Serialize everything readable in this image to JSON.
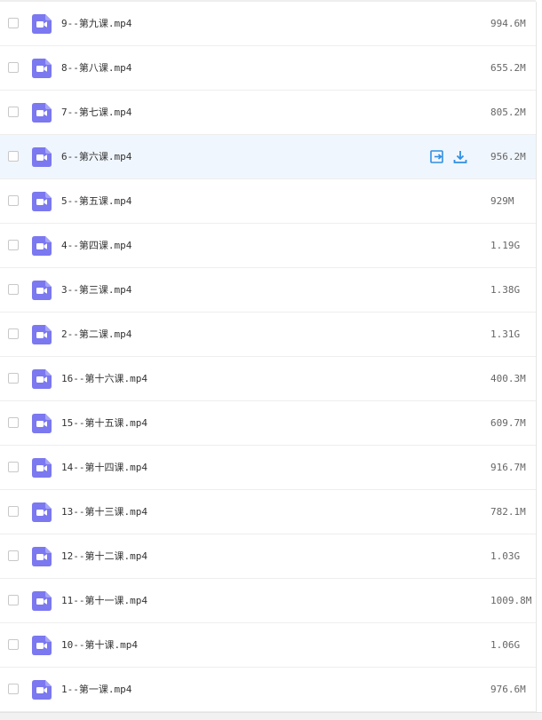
{
  "colors": {
    "icon_bg": "#7b78f0",
    "hover_bg": "#f0f6fd",
    "action_blue": "#2f8fe4",
    "divider": "#eeeeee"
  },
  "actions": {
    "share_icon": "share-icon",
    "download_icon": "download-icon"
  },
  "files": [
    {
      "name": "9--第九课.mp4",
      "size": "994.6M",
      "icon": "video-file-icon"
    },
    {
      "name": "8--第八课.mp4",
      "size": "655.2M",
      "icon": "video-file-icon"
    },
    {
      "name": "7--第七课.mp4",
      "size": "805.2M",
      "icon": "video-file-icon"
    },
    {
      "name": "6--第六课.mp4",
      "size": "956.2M",
      "icon": "video-file-icon",
      "hovered": true
    },
    {
      "name": "5--第五课.mp4",
      "size": "929M",
      "icon": "video-file-icon"
    },
    {
      "name": "4--第四课.mp4",
      "size": "1.19G",
      "icon": "video-file-icon"
    },
    {
      "name": "3--第三课.mp4",
      "size": "1.38G",
      "icon": "video-file-icon"
    },
    {
      "name": "2--第二课.mp4",
      "size": "1.31G",
      "icon": "video-file-icon"
    },
    {
      "name": "16--第十六课.mp4",
      "size": "400.3M",
      "icon": "video-file-icon"
    },
    {
      "name": "15--第十五课.mp4",
      "size": "609.7M",
      "icon": "video-file-icon"
    },
    {
      "name": "14--第十四课.mp4",
      "size": "916.7M",
      "icon": "video-file-icon"
    },
    {
      "name": "13--第十三课.mp4",
      "size": "782.1M",
      "icon": "video-file-icon"
    },
    {
      "name": "12--第十二课.mp4",
      "size": "1.03G",
      "icon": "video-file-icon"
    },
    {
      "name": "11--第十一课.mp4",
      "size": "1009.8M",
      "icon": "video-file-icon"
    },
    {
      "name": "10--第十课.mp4",
      "size": "1.06G",
      "icon": "video-file-icon"
    },
    {
      "name": "1--第一课.mp4",
      "size": "976.6M",
      "icon": "video-file-icon"
    }
  ]
}
